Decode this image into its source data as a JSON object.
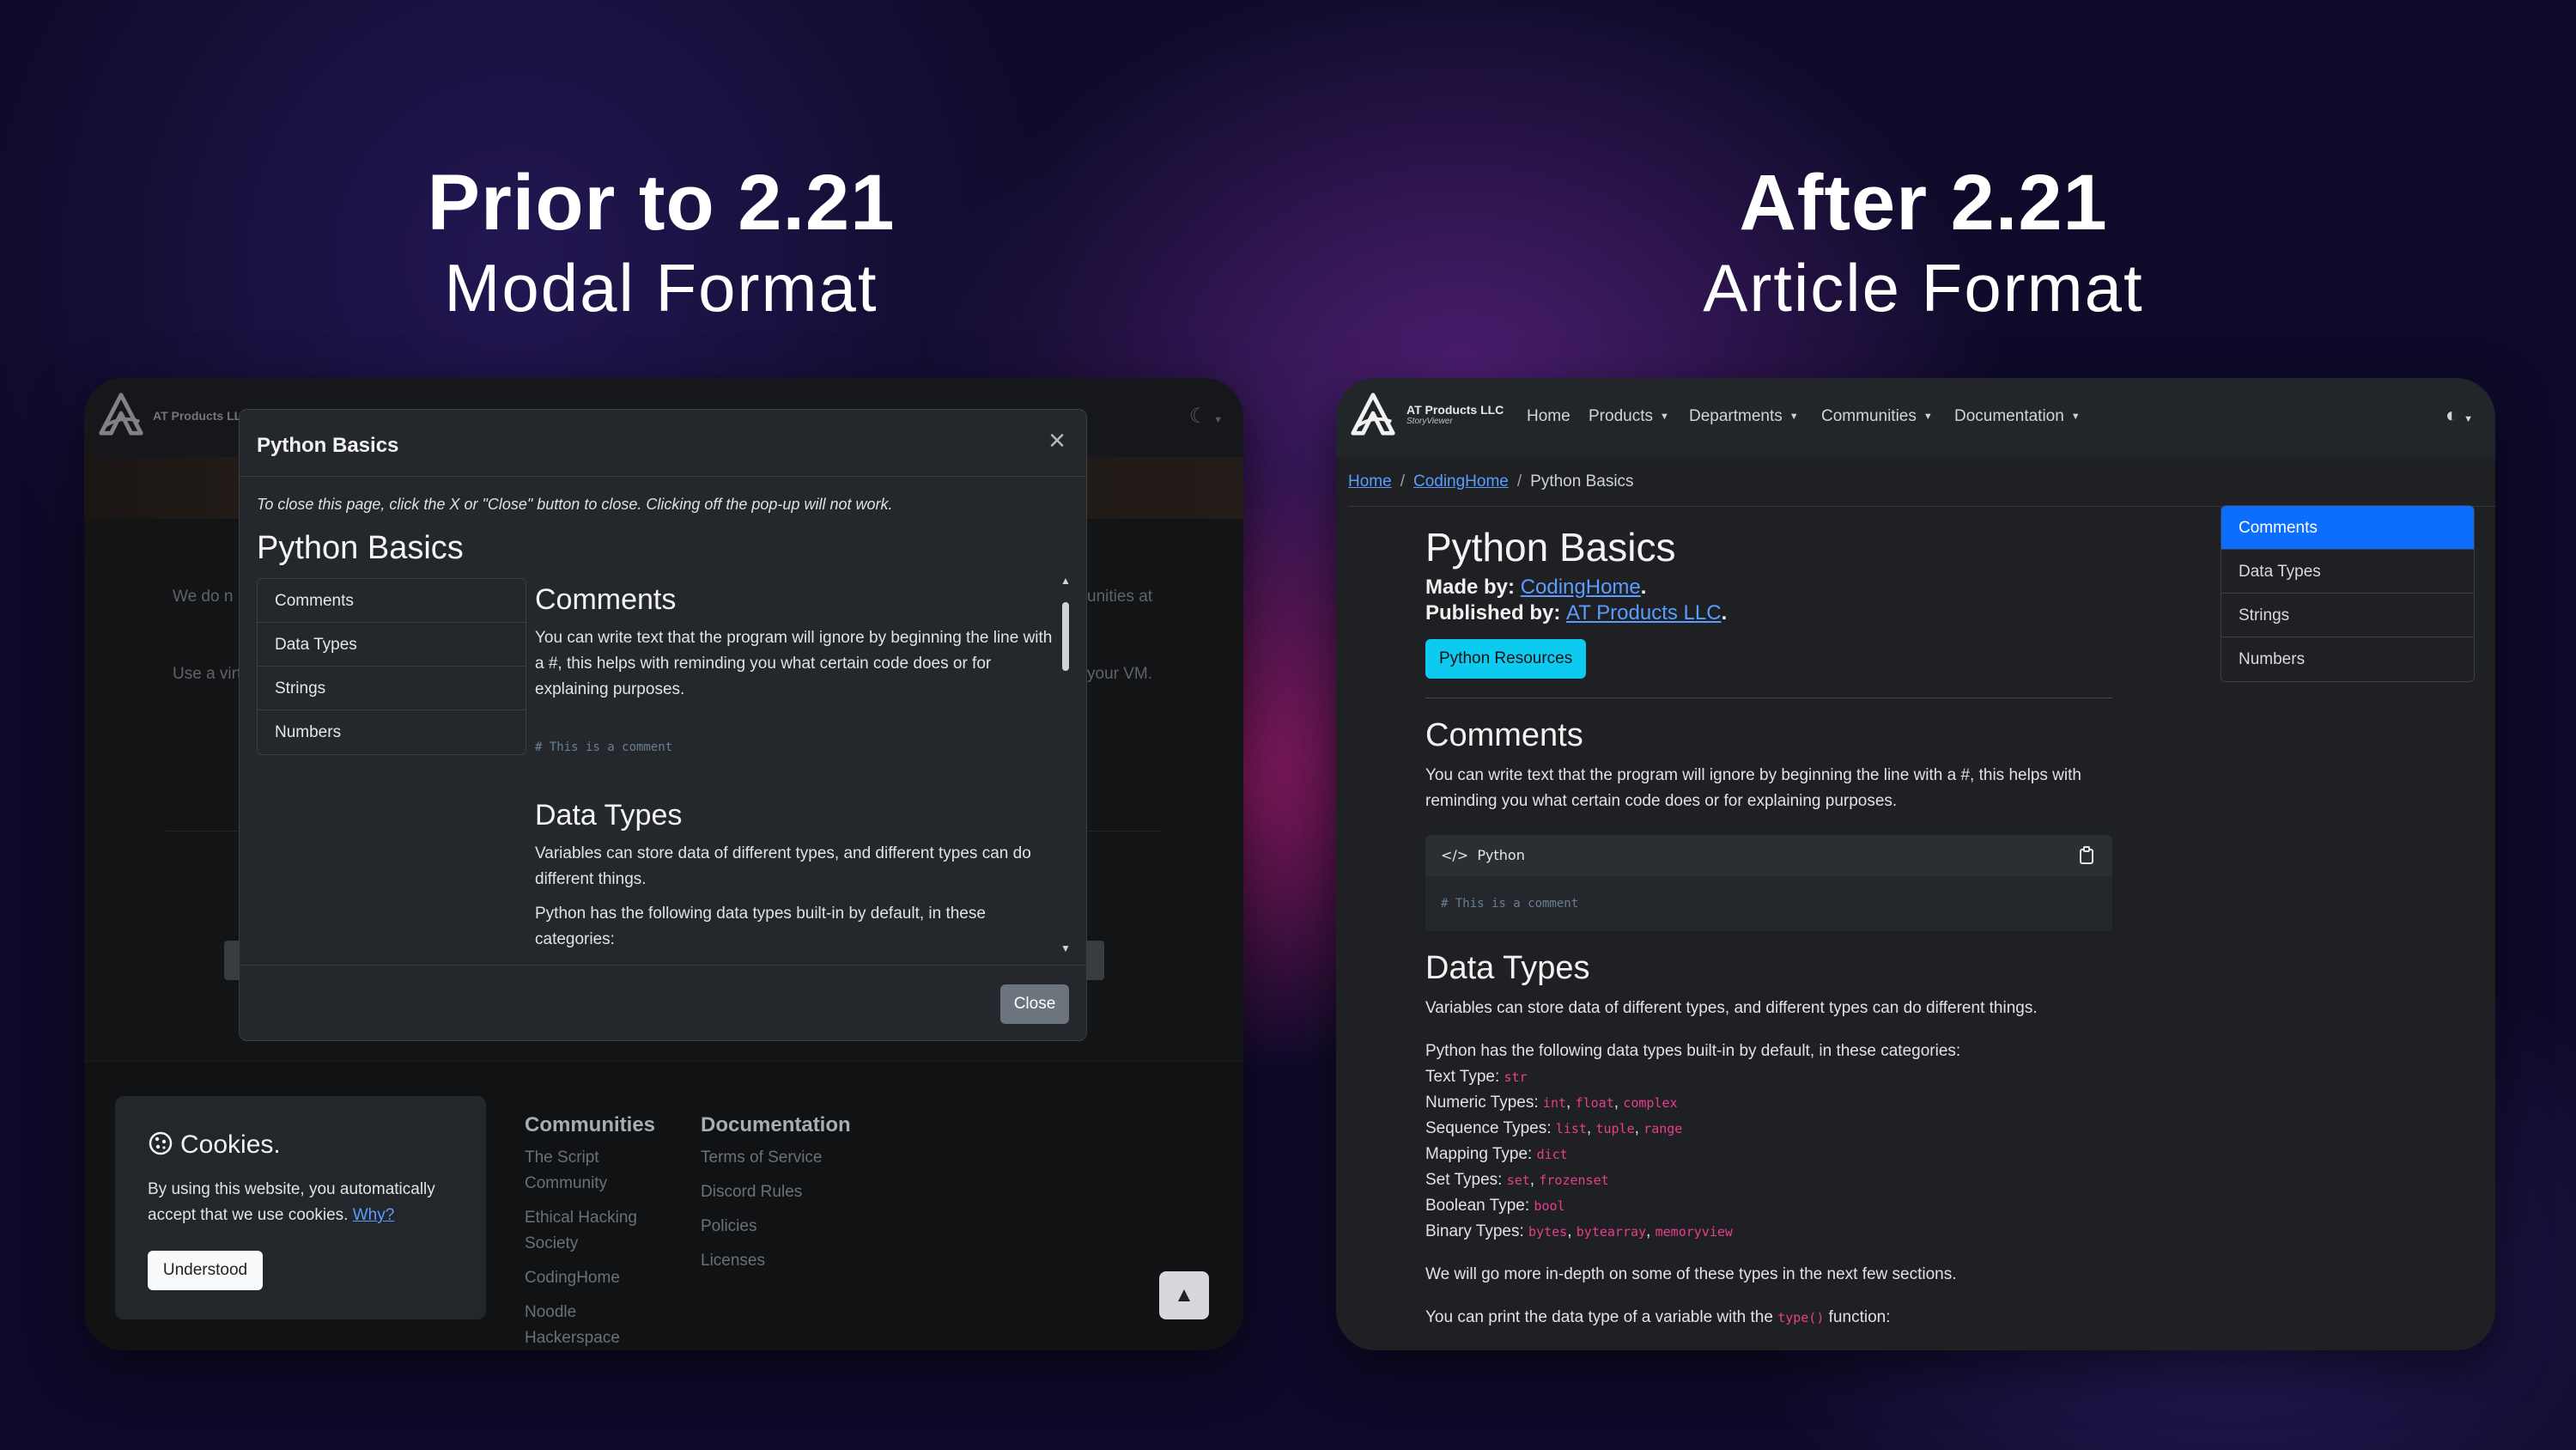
{
  "headings": {
    "left": {
      "main": "Prior to 2.21",
      "sub": "Modal Format"
    },
    "right": {
      "main": "After 2.21",
      "sub": "Article Format"
    }
  },
  "old": {
    "brand": "AT Products LL",
    "bg_text_1_left": "We do n",
    "bg_text_1_right": "unities at",
    "bg_text_2_left": "Use a virt",
    "bg_text_2_right": "your VM.",
    "modal": {
      "title": "Python Basics",
      "note": "To close this page, click the X or \"Close\" button to close. Clicking off the pop-up will not work.",
      "heading": "Python Basics",
      "toc": [
        "Comments",
        "Data Types",
        "Strings",
        "Numbers"
      ],
      "comments_heading": "Comments",
      "comments_text": "You can write text that the program will ignore by beginning the line with a #, this helps with reminding you what certain code does or for explaining purposes.",
      "comments_code": "# This is a comment",
      "datatypes_heading": "Data Types",
      "datatypes_text": "Variables can store data of different types, and different types can do different things.",
      "datatypes_text2": "Python has the following data types built-in by default, in these categories:",
      "close_label": "Close"
    },
    "cookie": {
      "title": "Cookies.",
      "text": "By using this website, you automatically accept that we use cookies.",
      "why": "Why?",
      "button": "Understood"
    },
    "footer": {
      "communities_heading": "Communities",
      "communities": [
        "The Script Community",
        "Ethical Hacking Society",
        "CodingHome",
        "Noodle Hackerspace"
      ],
      "documentation_heading": "Documentation",
      "documentation": [
        "Terms of Service",
        "Discord Rules",
        "Policies",
        "Licenses"
      ]
    }
  },
  "new": {
    "brand_line1": "AT Products LLC",
    "brand_line2": "StoryViewer",
    "nav": [
      "Home",
      "Products",
      "Departments",
      "Communities",
      "Documentation"
    ],
    "breadcrumb": [
      "Home",
      "CodingHome",
      "Python Basics"
    ],
    "title": "Python Basics",
    "made_by_label": "Made by:",
    "made_by": "CodingHome",
    "published_by_label": "Published by:",
    "published_by": "AT Products LLC",
    "resources_button": "Python Resources",
    "comments_heading": "Comments",
    "comments_text": "You can write text that the program will ignore by beginning the line with a #, this helps with reminding you what certain code does or for explaining purposes.",
    "code_lang": "Python",
    "code_comment": "# This is a comment",
    "datatypes_heading": "Data Types",
    "datatypes_text": "Variables can store data of different types, and different types can do different things.",
    "datatypes_intro": "Python has the following data types built-in by default, in these categories:",
    "type_rows": [
      {
        "label": "Text Type:",
        "values": [
          "str"
        ]
      },
      {
        "label": "Numeric Types:",
        "values": [
          "int",
          "float",
          "complex"
        ]
      },
      {
        "label": "Sequence Types:",
        "values": [
          "list",
          "tuple",
          "range"
        ]
      },
      {
        "label": "Mapping Type:",
        "values": [
          "dict"
        ]
      },
      {
        "label": "Set Types:",
        "values": [
          "set",
          "frozenset"
        ]
      },
      {
        "label": "Boolean Type:",
        "values": [
          "bool"
        ]
      },
      {
        "label": "Binary Types:",
        "values": [
          "bytes",
          "bytearray",
          "memoryview"
        ]
      }
    ],
    "more_text": "We will go more in-depth on some of these types in the next few sections.",
    "print_text_pre": "You can print the data type of a variable with the",
    "print_text_code": "type()",
    "print_text_post": "function:",
    "toc": [
      "Comments",
      "Data Types",
      "Strings",
      "Numbers"
    ],
    "toc_active": "Comments"
  },
  "colors": {
    "accent_blue": "#0d6efd",
    "link_blue": "#5b9dff",
    "info_cyan": "#0dcaf0",
    "code_pink": "#e83e8c"
  }
}
